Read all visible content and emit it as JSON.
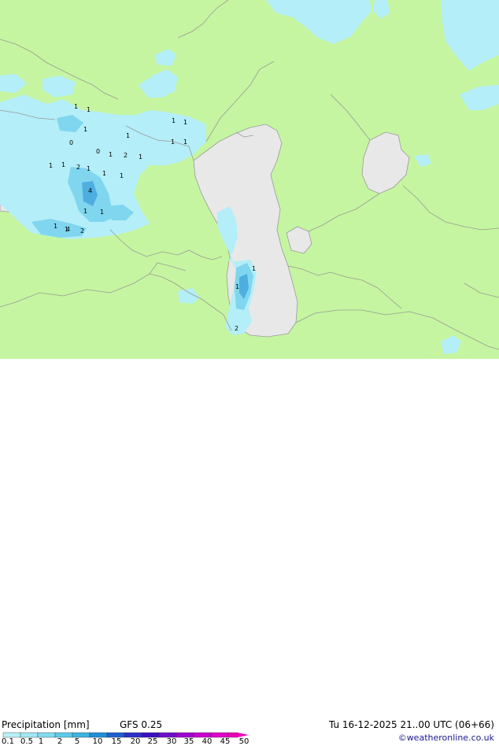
{
  "title": "Precipitation [mm]",
  "model": "GFS 0.25",
  "valid_time": "Tu 16-12-2025 21..00 UTC (06+66)",
  "credit": "©weatheronline.co.uk",
  "colors": {
    "land": "#c5f5a0",
    "water": "#e8e8e8",
    "border": "#9a9a9a",
    "precip_light": "#b4eef8",
    "precip_mid": "#7fd6ee",
    "precip_heavy": "#4faee0"
  },
  "scale": {
    "labels": [
      "0.1",
      "0.5",
      "1",
      "2",
      "5",
      "10",
      "15",
      "20",
      "25",
      "30",
      "35",
      "40",
      "45",
      "50"
    ],
    "colors": [
      "#b8f0f8",
      "#a0e8f4",
      "#80dcf0",
      "#5ccbe8",
      "#3cb4e0",
      "#2090d8",
      "#1f5fd0",
      "#2a30c8",
      "#3a10c0",
      "#7010c8",
      "#a000d0",
      "#c800d0",
      "#e000c8",
      "#f000b8"
    ]
  },
  "map_labels": [
    {
      "text": "1"
    },
    {
      "text": "1"
    },
    {
      "text": "0"
    },
    {
      "text": "1"
    },
    {
      "text": "0"
    },
    {
      "text": "1"
    },
    {
      "text": "1"
    },
    {
      "text": "2"
    },
    {
      "text": "1"
    },
    {
      "text": "1"
    },
    {
      "text": "1"
    },
    {
      "text": "1"
    },
    {
      "text": "2"
    },
    {
      "text": "1"
    },
    {
      "text": "4"
    },
    {
      "text": "1"
    },
    {
      "text": "1"
    },
    {
      "text": "1"
    },
    {
      "text": "1"
    },
    {
      "text": "4"
    },
    {
      "text": "2"
    },
    {
      "text": "1"
    },
    {
      "text": "1"
    },
    {
      "text": "1"
    },
    {
      "text": "1"
    },
    {
      "text": "1"
    },
    {
      "text": "1"
    },
    {
      "text": "1"
    },
    {
      "text": "2"
    }
  ]
}
